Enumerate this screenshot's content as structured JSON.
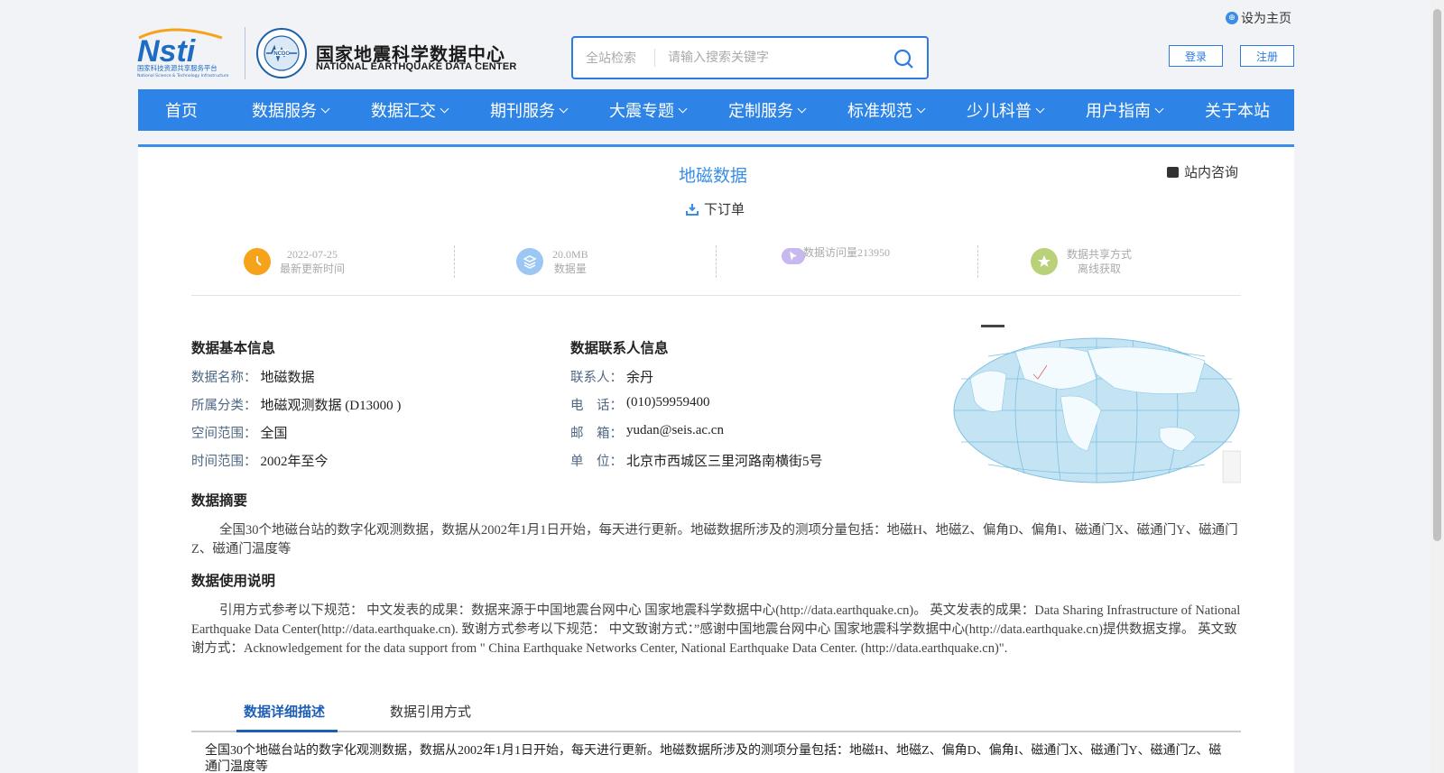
{
  "header": {
    "set_home": "设为主页",
    "logo_left_caption": "国家科技资源共享服务平台",
    "logo_left_caption_en": "National Science & Technology Infrastructure",
    "site_title": "国家地震科学数据中心",
    "site_title_en": "NATIONAL EARTHQUAKE DATA CENTER",
    "search_scope": "全站检索",
    "search_placeholder": "请输入搜索关键字",
    "login": "登录",
    "register": "注册"
  },
  "nav": [
    {
      "label": "首页",
      "dropdown": false
    },
    {
      "label": "数据服务",
      "dropdown": true
    },
    {
      "label": "数据汇交",
      "dropdown": true
    },
    {
      "label": "期刊服务",
      "dropdown": true
    },
    {
      "label": "大震专题",
      "dropdown": true
    },
    {
      "label": "定制服务",
      "dropdown": true
    },
    {
      "label": "标准规范",
      "dropdown": true
    },
    {
      "label": "少儿科普",
      "dropdown": true
    },
    {
      "label": "用户指南",
      "dropdown": true
    },
    {
      "label": "关于本站",
      "dropdown": false
    }
  ],
  "dataset": {
    "title": "地磁数据",
    "order_label": "下订单",
    "consult_label": "站内咨询"
  },
  "stats": {
    "updated_value": "2022-07-25",
    "updated_label": "最新更新时间",
    "size_value": "20.0MB",
    "size_label": "数据量",
    "visits_label": "数据访问量213950",
    "share_label": "数据共享方式",
    "share_value": "离线获取"
  },
  "basic_info": {
    "heading": "数据基本信息",
    "name_k": "数据名称：",
    "name_v": "地磁数据",
    "category_k": "所属分类：",
    "category_v": "地磁观测数据 (D13000 )",
    "space_k": "空间范围：",
    "space_v": "全国",
    "time_k": "时间范围：",
    "time_v": "2002年至今"
  },
  "contact_info": {
    "heading": "数据联系人信息",
    "person_k": "联系人：",
    "person_v": "余丹",
    "phone_k": "电　话：",
    "phone_v": "(010)59959400",
    "email_k": "邮　箱：",
    "email_v": "yudan@seis.ac.cn",
    "org_k": "单　位：",
    "org_v": "北京市西城区三里河路南横街5号"
  },
  "summary": {
    "heading": "数据摘要",
    "text": "全国30个地磁台站的数字化观测数据，数据从2002年1月1日开始，每天进行更新。地磁数据所涉及的测项分量包括：地磁H、地磁Z、偏角D、偏角I、磁通门X、磁通门Y、磁通门Z、磁通门温度等"
  },
  "usage": {
    "heading": "数据使用说明",
    "text": "引用方式参考以下规范： 中文发表的成果：数据来源于中国地震台网中心 国家地震科学数据中心(http://data.earthquake.cn)。 英文发表的成果：Data Sharing Infrastructure of National Earthquake Data Center(http://data.earthquake.cn). 致谢方式参考以下规范： 中文致谢方式：”感谢中国地震台网中心 国家地震科学数据中心(http://data.earthquake.cn)提供数据支撑。 英文致谢方式：Acknowledgement for the data support from \" China Earthquake Networks Center, National Earthquake Data Center. (http://data.earthquake.cn)\"."
  },
  "tabs": {
    "detail": "数据详细描述",
    "citation": "数据引用方式"
  },
  "detail_text": "全国30个地磁台站的数字化观测数据，数据从2002年1月1日开始，每天进行更新。地磁数据所涉及的测项分量包括：地磁H、地磁Z、偏角D、偏角I、磁通门X、磁通门Y、磁通门Z、磁通门温度等",
  "colors": {
    "primary": "#2d84e6",
    "title_blue": "#3a8ee6",
    "clock_orange": "#f7a21b",
    "layers_blue": "#9cc7f2",
    "star_green": "#b9d27a"
  }
}
